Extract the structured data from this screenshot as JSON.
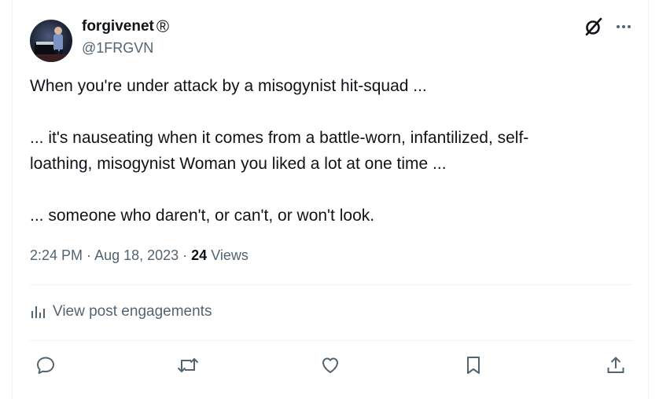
{
  "author": {
    "display_name": "forgivenet",
    "name_badge": "®",
    "handle": "@1FRGVN",
    "avatar": "pianist-photo"
  },
  "header_icons": [
    "grok-icon",
    "more-icon"
  ],
  "post": {
    "text": "When you're under attack by a misogynist hit-squad ...\n\n... it's nauseating when it comes from a battle-worn, infantilized, self-\nloathing, misogynist Woman you liked a lot at one time ...\n\n... someone who daren't, or can't, or won't look.",
    "time": "2:24 PM",
    "separator": " · ",
    "date": "Aug 18, 2023",
    "views_count": "24",
    "views_label": "Views"
  },
  "engagements": {
    "label": "View post engagements",
    "icon": "analytics-icon"
  },
  "actions": [
    {
      "name": "reply",
      "icon": "reply-icon"
    },
    {
      "name": "repost",
      "icon": "repost-icon"
    },
    {
      "name": "like",
      "icon": "like-icon"
    },
    {
      "name": "bookmark",
      "icon": "bookmark-icon"
    },
    {
      "name": "share",
      "icon": "share-icon"
    }
  ],
  "colors": {
    "text": "#0f1419",
    "secondary": "#536471",
    "divider": "#eff3f4"
  }
}
